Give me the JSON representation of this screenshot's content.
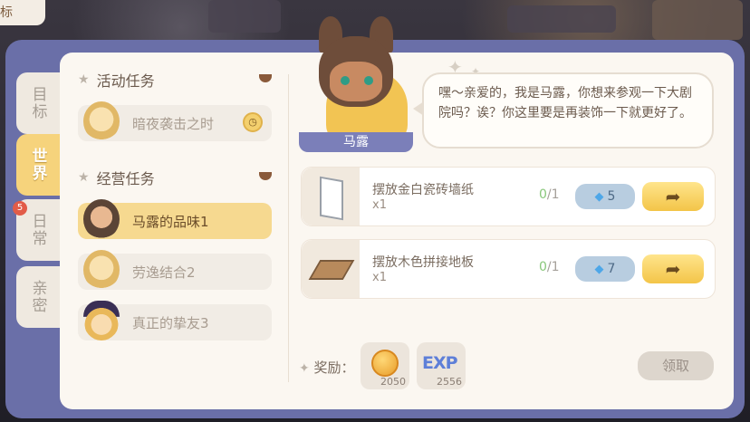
{
  "top_tab": {
    "label": "标"
  },
  "side_tabs": [
    {
      "label": "目标",
      "active": false
    },
    {
      "label": "世界",
      "active": true
    },
    {
      "label": "日常",
      "active": false,
      "badge": "5"
    },
    {
      "label": "亲密",
      "active": false
    }
  ],
  "sections": [
    {
      "title": "活动任务",
      "quests": [
        {
          "label": "暗夜袭击之时",
          "active": false,
          "timed": true
        }
      ]
    },
    {
      "title": "经营任务",
      "quests": [
        {
          "label": "马露的品味1",
          "active": true
        },
        {
          "label": "劳逸结合2",
          "active": false
        },
        {
          "label": "真正的挚友3",
          "active": false
        }
      ]
    }
  ],
  "npc": {
    "name": "马露",
    "dialogue": "嘿～亲爱的，我是马露，你想来参观一下大剧院吗？诶？你这里要是再装饰一下就更好了。"
  },
  "tasks": [
    {
      "name": "摆放金白瓷砖墙纸",
      "count": "x1",
      "progress_done": "0",
      "progress_total": "/1",
      "gem_cost": "5"
    },
    {
      "name": "摆放木色拼接地板",
      "count": "x1",
      "progress_done": "0",
      "progress_total": "/1",
      "gem_cost": "7"
    }
  ],
  "rewards": {
    "label": "奖励：",
    "items": [
      {
        "icon": "coin-icon",
        "amount": "2050"
      },
      {
        "icon": "exp-icon",
        "text": "EXP",
        "amount": "2556"
      }
    ]
  },
  "claim_button": "领取",
  "colors": {
    "accent": "#f6d37c",
    "frame": "#6a6fa8",
    "panel": "#fbf7f1"
  }
}
